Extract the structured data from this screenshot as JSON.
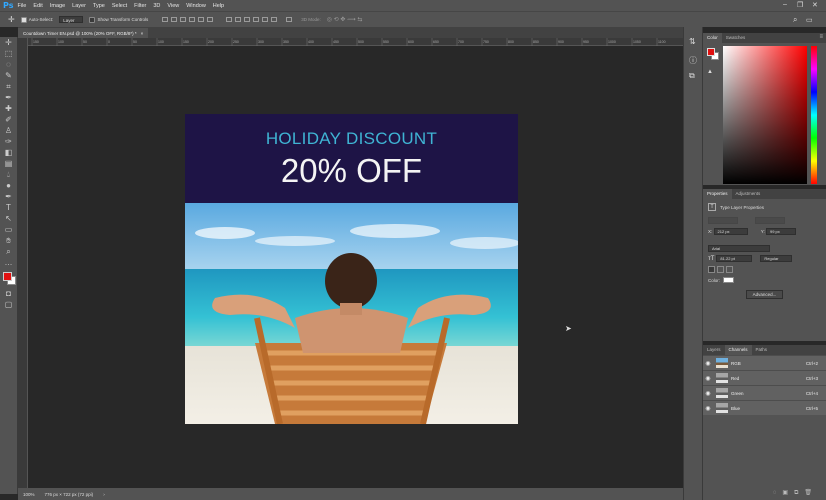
{
  "app": {
    "logo": "Ps"
  },
  "menu": [
    "File",
    "Edit",
    "Image",
    "Layer",
    "Type",
    "Select",
    "Filter",
    "3D",
    "View",
    "Window",
    "Help"
  ],
  "window_controls": {
    "minimize": "–",
    "restore": "❐",
    "close": "✕"
  },
  "options_bar": {
    "auto_select_label": "Auto-Select:",
    "auto_select_value": "Layer",
    "show_transform_label": "Show Transform Controls",
    "mode_3d_label": "3D Mode:"
  },
  "document_tab": {
    "title": "Countdown Timer EN.psd @ 100% (20% OFF, RGB/8*) *",
    "close": "×"
  },
  "ruler_ticks": [
    "150",
    "100",
    "50",
    "0",
    "50",
    "100",
    "150",
    "200",
    "250",
    "300",
    "350",
    "400",
    "450",
    "500",
    "550",
    "600",
    "650",
    "700",
    "750",
    "800",
    "850",
    "900",
    "950",
    "1000",
    "1050",
    "1100"
  ],
  "artboard": {
    "headline": "HOLIDAY DISCOUNT",
    "offer": "20% OFF",
    "banner_color": "#1e1446",
    "headline_color": "#3fb4d4"
  },
  "status_bar": {
    "zoom": "100%",
    "doc_info": "776 px × 722 px (72 ppi)",
    "arrow": "›"
  },
  "color_panel": {
    "tabs": [
      "Color",
      "Swatches"
    ],
    "fg": "#e01010",
    "bg": "#ffffff"
  },
  "properties_panel": {
    "tabs": [
      "Properties",
      "Adjustments"
    ],
    "title": "Type Layer Properties",
    "x_label": "X:",
    "x_value": "212 px",
    "y_label": "Y:",
    "y_value": "99 px",
    "font": "Arial",
    "size": "81.22 pt",
    "style": "Regular",
    "color_label": "Color:",
    "advanced": "Advanced..."
  },
  "channels_panel": {
    "tabs": [
      "Layers",
      "Channels",
      "Paths"
    ],
    "rows": [
      {
        "name": "RGB",
        "shortcut": "Ctrl+2"
      },
      {
        "name": "Red",
        "shortcut": "Ctrl+3"
      },
      {
        "name": "Green",
        "shortcut": "Ctrl+4"
      },
      {
        "name": "Blue",
        "shortcut": "Ctrl+5"
      }
    ]
  }
}
